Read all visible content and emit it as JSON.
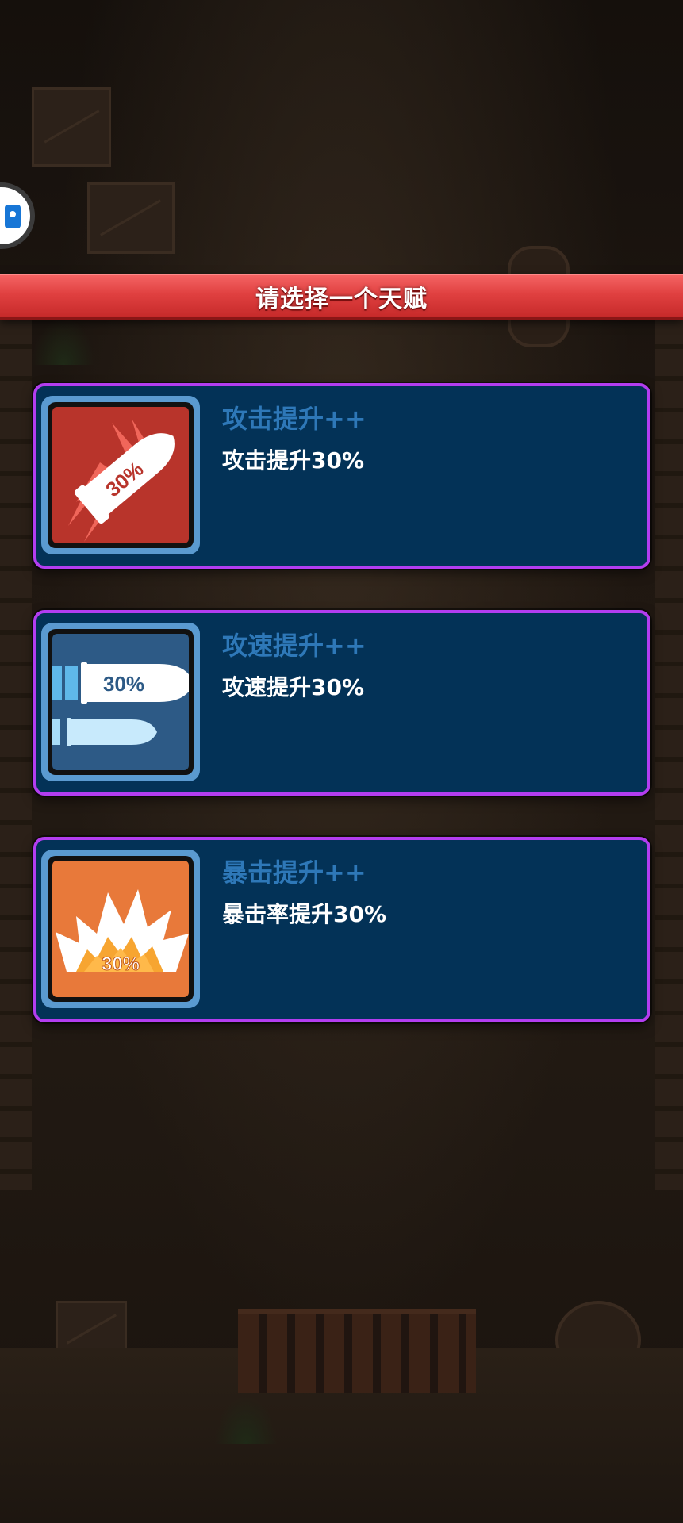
{
  "title": "请选择一个天赋",
  "talents": [
    {
      "name": "攻击提升++",
      "description": "攻击提升30%",
      "icon": "rocket-bullet-icon",
      "icon_label": "30%",
      "icon_bg": "#b8342b"
    },
    {
      "name": "攻速提升++",
      "description": "攻速提升30%",
      "icon": "double-bullet-icon",
      "icon_label": "30%",
      "icon_bg": "#2d5a86"
    },
    {
      "name": "暴击提升++",
      "description": "暴击率提升30%",
      "icon": "explosion-icon",
      "icon_label": "30%",
      "icon_bg": "#e8793a"
    }
  ],
  "colors": {
    "banner": "#e04040",
    "card_bg": "#033257",
    "card_border": "#b33df0",
    "talent_name": "#2e78b8",
    "talent_desc": "#ffffff"
  }
}
